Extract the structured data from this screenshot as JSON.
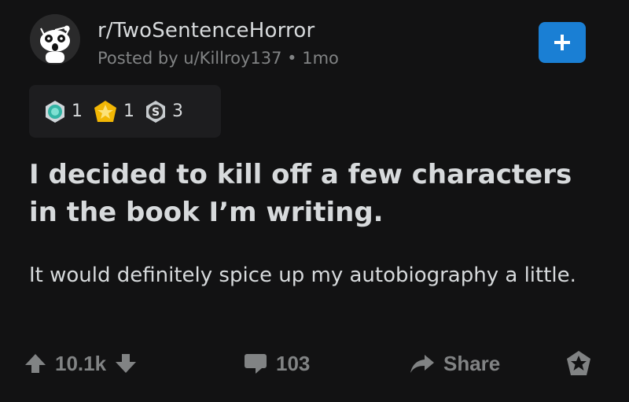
{
  "post": {
    "subreddit": "r/TwoSentenceHorror",
    "meta": "Posted by u/Killroy137 • 1mo",
    "title": "I decided to kill off a few characters in the book I’m writing.",
    "body": "It would definitely spice up my autobiography a little."
  },
  "awards": [
    {
      "icon": "helpful-award-icon",
      "count": "1"
    },
    {
      "icon": "gold-award-icon",
      "count": "1"
    },
    {
      "icon": "silver-award-icon",
      "count": "3"
    }
  ],
  "actions": {
    "upvotes": "10.1k",
    "comments": "103",
    "share": "Share"
  },
  "colors": {
    "background": "#121213",
    "text": "#d7dadc",
    "muted": "#818384",
    "accent_blue": "#1a7fd4",
    "award_bg": "#1d1d1f"
  }
}
